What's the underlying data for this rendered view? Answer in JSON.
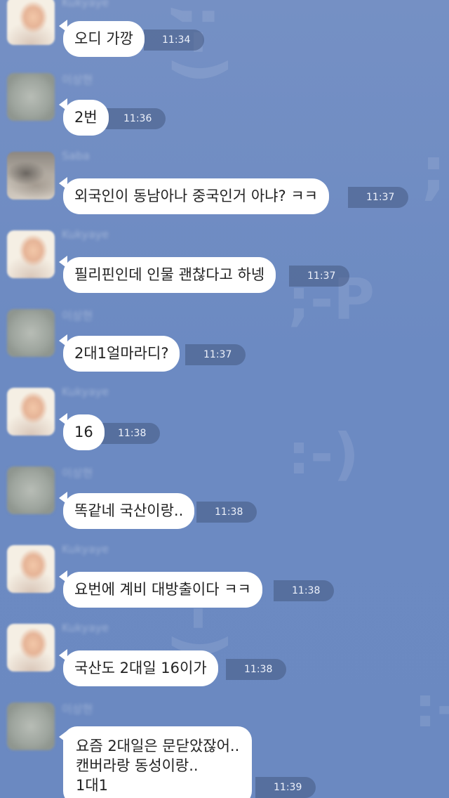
{
  "messages": [
    {
      "avatar": "a",
      "name": "Kukyaye",
      "text": "오디 가깡",
      "time": "11:34"
    },
    {
      "avatar": "b",
      "name": "이상현",
      "text": "2번",
      "time": "11:36"
    },
    {
      "avatar": "c",
      "name": "Saba",
      "text": "외국인이 동남아나 중국인거 아냐? ㅋㅋ",
      "time": "11:37"
    },
    {
      "avatar": "a",
      "name": "Kukyaye",
      "text": "필리핀인데 인물 괜찮다고 하넹",
      "time": "11:37"
    },
    {
      "avatar": "b",
      "name": "이상현",
      "text": "2대1얼마라디?",
      "time": "11:37"
    },
    {
      "avatar": "a",
      "name": "Kukyaye",
      "text": "16",
      "time": "11:38"
    },
    {
      "avatar": "b",
      "name": "이상현",
      "text": "똑같네 국산이랑..",
      "time": "11:38"
    },
    {
      "avatar": "a",
      "name": "Kukyaye",
      "text": "요번에 계비 대방출이다 ㅋㅋ",
      "time": "11:38"
    },
    {
      "avatar": "a",
      "name": "Kukyaye",
      "text": "국산도 2대일 16이가",
      "time": "11:38"
    },
    {
      "avatar": "b",
      "name": "이상현",
      "text": "요즘 2대일은 문닫았잖어..\n캔버라랑 동성이랑..\n1대1",
      "time": "11:39"
    }
  ],
  "background_emoticons": [
    ";-)",
    ";-P",
    ":-)",
    ";-)",
    ";",
    ":-P"
  ],
  "colors": {
    "background": "#6f8cc3",
    "bubble": "#ffffff",
    "time_pill": "#465a82"
  }
}
